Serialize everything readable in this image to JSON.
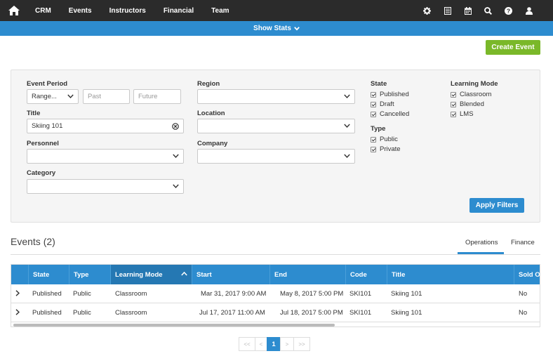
{
  "nav": {
    "items": [
      "CRM",
      "Events",
      "Instructors",
      "Financial",
      "Team"
    ],
    "icons": [
      "home-icon",
      "gear-icon",
      "list-icon",
      "calendar-icon",
      "search-icon",
      "help-icon",
      "user-icon"
    ]
  },
  "stats_bar": {
    "label": "Show Stats"
  },
  "create_event_label": "Create Event",
  "filters": {
    "event_period": {
      "label": "Event Period",
      "range_value": "Range...",
      "past_placeholder": "Past",
      "future_placeholder": "Future"
    },
    "title": {
      "label": "Title",
      "value": "Skiing 101"
    },
    "personnel": {
      "label": "Personnel",
      "value": ""
    },
    "category": {
      "label": "Category",
      "value": ""
    },
    "region": {
      "label": "Region",
      "value": ""
    },
    "location": {
      "label": "Location",
      "value": ""
    },
    "company": {
      "label": "Company",
      "value": ""
    },
    "state": {
      "label": "State",
      "options": [
        "Published",
        "Draft",
        "Cancelled"
      ]
    },
    "type": {
      "label": "Type",
      "options": [
        "Public",
        "Private"
      ]
    },
    "learning_mode": {
      "label": "Learning Mode",
      "options": [
        "Classroom",
        "Blended",
        "LMS"
      ]
    },
    "apply_label": "Apply Filters"
  },
  "events": {
    "title": "Events (2)",
    "tabs": [
      "Operations",
      "Finance"
    ],
    "active_tab": "Operations",
    "columns": [
      "State",
      "Type",
      "Learning Mode",
      "Start",
      "End",
      "Code",
      "Title",
      "Sold Out"
    ],
    "sorted_column": "Learning Mode",
    "rows": [
      {
        "state": "Published",
        "type": "Public",
        "mode": "Classroom",
        "start": "Mar 31, 2017 9:00 AM",
        "end": "May 8, 2017 5:00 PM",
        "code": "SKI101",
        "title": "Skiing 101",
        "sold_out": "No"
      },
      {
        "state": "Published",
        "type": "Public",
        "mode": "Classroom",
        "start": "Jul 17, 2017 11:00 AM",
        "end": "Jul 18, 2017 5:00 PM",
        "code": "SKI101",
        "title": "Skiing 101",
        "sold_out": "No"
      }
    ]
  },
  "pagination": {
    "first": "<<",
    "prev": "<",
    "current": "1",
    "next": ">",
    "last": ">>"
  },
  "colors": {
    "nav_bg": "#2b2b2b",
    "accent": "#2d8ccf",
    "create": "#7ab829"
  }
}
